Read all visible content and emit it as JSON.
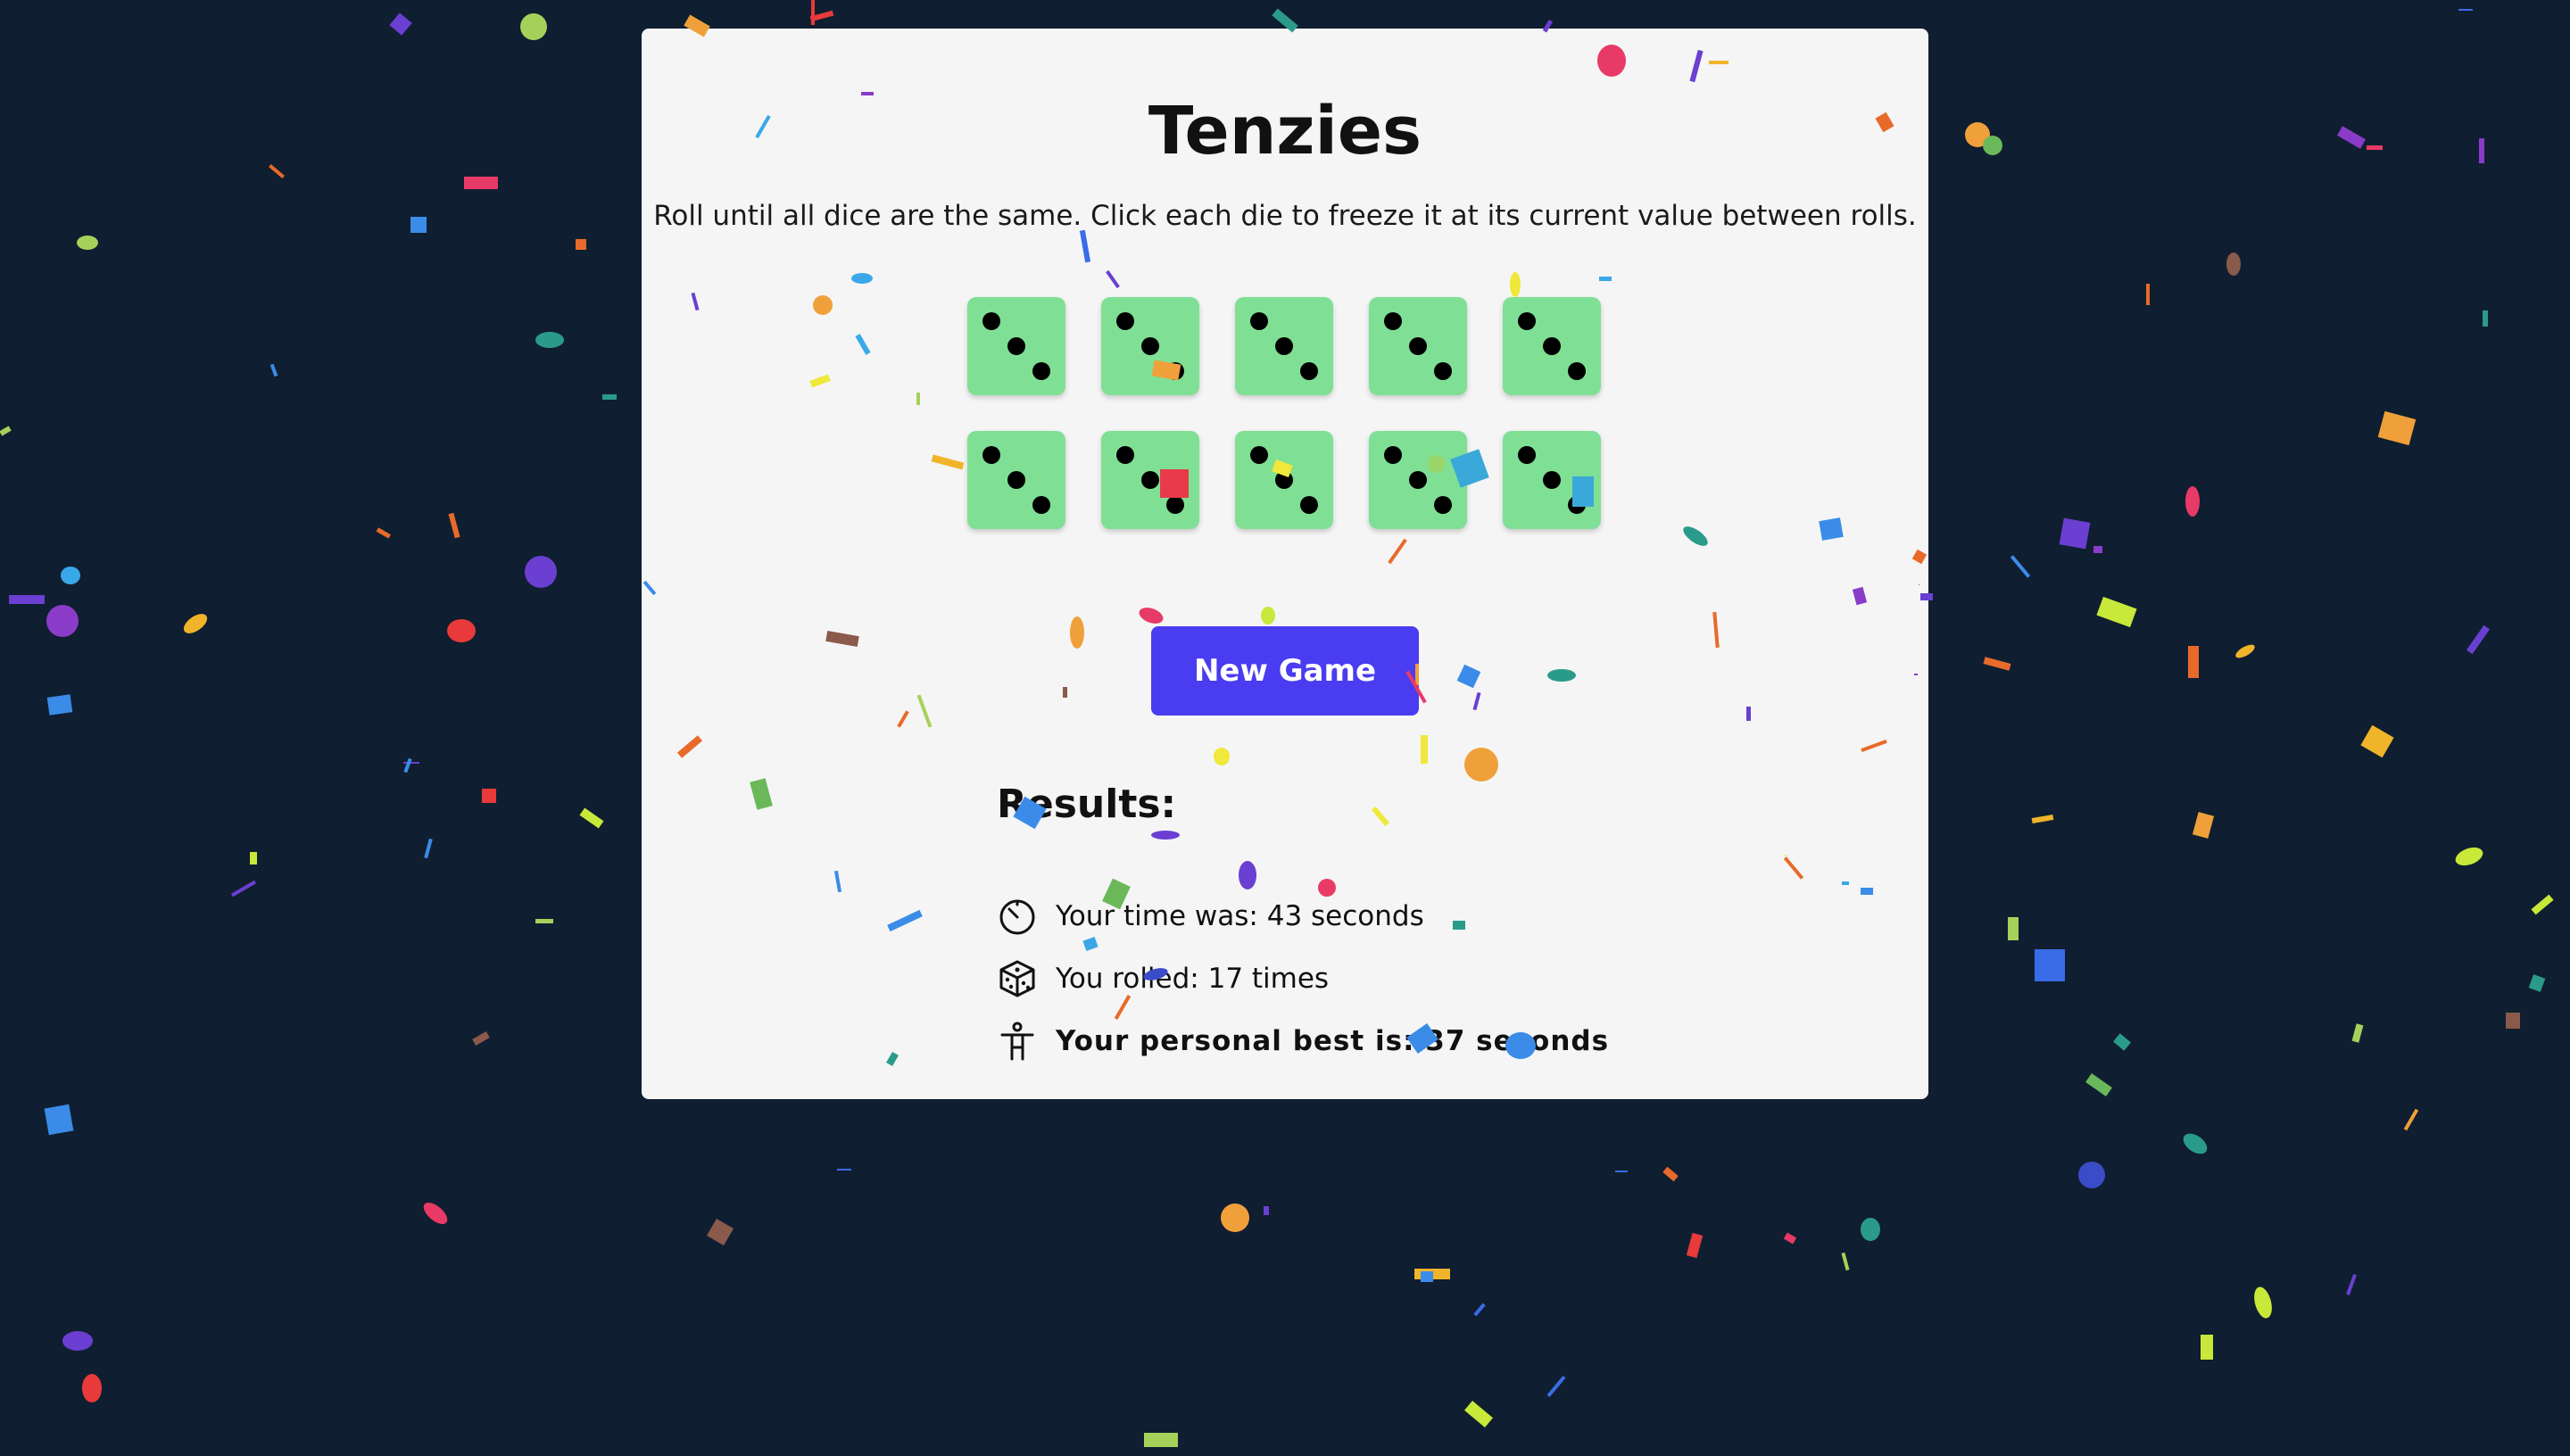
{
  "game": {
    "title": "Tenzies",
    "instructions": "Roll until all dice are the same. Click each die to freeze it at its current value between rolls.",
    "dice": [
      3,
      3,
      3,
      3,
      3,
      3,
      3,
      3,
      3,
      3
    ],
    "new_game_label": "New Game"
  },
  "results": {
    "heading": "Results:",
    "time_text": "Your time was: 43 seconds",
    "rolls_text": "You rolled: 17 times",
    "best_text": "Your personal best is: 37 seconds"
  },
  "icons": {
    "time": "stopwatch-icon",
    "rolls": "dice-icon",
    "best": "person-icon"
  },
  "colors": {
    "background": "#0f1e30",
    "card": "#f5f5f5",
    "die": "#7fe095",
    "button": "#4a3cf0"
  }
}
